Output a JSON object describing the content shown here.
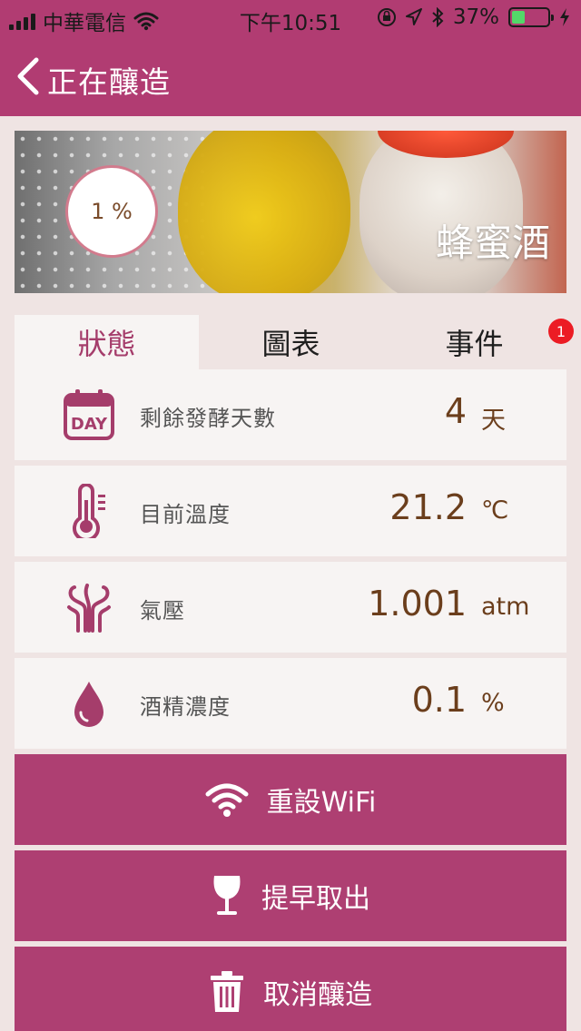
{
  "status_bar": {
    "carrier": "中華電信",
    "time": "下午10:51",
    "battery_percent": "37%",
    "battery_level": 0.37
  },
  "nav": {
    "title": "正在釀造"
  },
  "hero": {
    "progress": "1 %",
    "name": "蜂蜜酒"
  },
  "tabs": [
    {
      "label": "狀態",
      "active": true
    },
    {
      "label": "圖表",
      "active": false
    },
    {
      "label": "事件",
      "active": false,
      "badge": "1"
    }
  ],
  "metrics": [
    {
      "label": "剩餘發酵天數",
      "value": "4",
      "unit": "天",
      "icon": "calendar-day-icon"
    },
    {
      "label": "目前溫度",
      "value": "21.2",
      "unit": "℃",
      "icon": "thermometer-icon"
    },
    {
      "label": "氣壓",
      "value": "1.001",
      "unit": "atm",
      "icon": "pressure-icon"
    },
    {
      "label": "酒精濃度",
      "value": "0.1",
      "unit": "%",
      "icon": "drop-icon"
    }
  ],
  "actions": [
    {
      "label": "重設WiFi",
      "icon": "wifi-icon"
    },
    {
      "label": "提早取出",
      "icon": "wine-glass-icon"
    },
    {
      "label": "取消釀造",
      "icon": "trash-icon"
    }
  ],
  "colors": {
    "brand": "#b13c72",
    "button": "#ae3f72",
    "value_text": "#6b3e1c",
    "background": "#efe4e3"
  }
}
